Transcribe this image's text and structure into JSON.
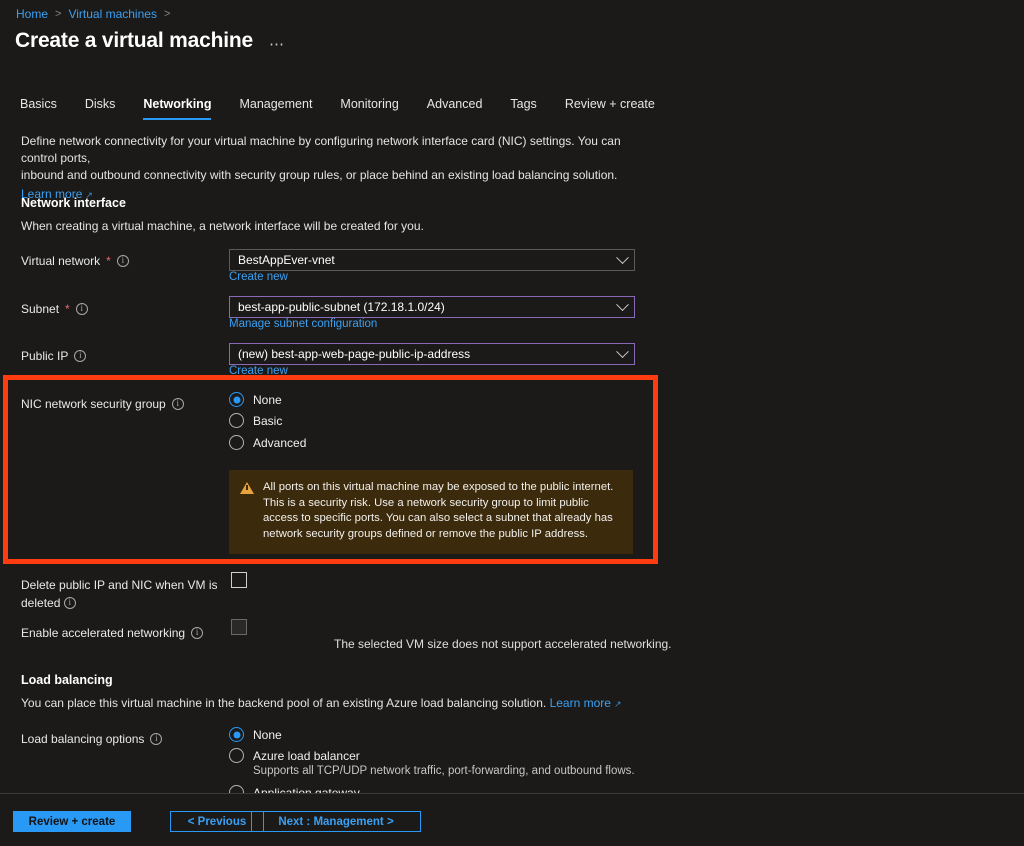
{
  "breadcrumb": {
    "home": "Home",
    "section": "Virtual machines"
  },
  "header": {
    "title": "Create a virtual machine",
    "more_label": "⋯"
  },
  "tabs": [
    {
      "label": "Basics",
      "active": false
    },
    {
      "label": "Disks",
      "active": false
    },
    {
      "label": "Networking",
      "active": true
    },
    {
      "label": "Management",
      "active": false
    },
    {
      "label": "Monitoring",
      "active": false
    },
    {
      "label": "Advanced",
      "active": false
    },
    {
      "label": "Tags",
      "active": false
    },
    {
      "label": "Review + create",
      "active": false
    }
  ],
  "intro": {
    "line1": "Define network connectivity for your virtual machine by configuring network interface card (NIC) settings. You can control ports,",
    "line2": "inbound and outbound connectivity with security group rules, or place behind an existing load balancing solution.",
    "learn_more": "Learn more"
  },
  "network_interface": {
    "heading": "Network interface",
    "subtext": "When creating a virtual machine, a network interface will be created for you.",
    "virtual_network": {
      "label": "Virtual network",
      "required": "*",
      "value": "BestAppEver-vnet",
      "sublink": "Create new"
    },
    "subnet": {
      "label": "Subnet",
      "required": "*",
      "value": "best-app-public-subnet (172.18.1.0/24)",
      "sublink": "Manage subnet configuration"
    },
    "public_ip": {
      "label": "Public IP",
      "value": "(new) best-app-web-page-public-ip-address",
      "sublink": "Create new"
    },
    "nic_nsg": {
      "label": "NIC network security group",
      "options": [
        {
          "label": "None",
          "selected": true
        },
        {
          "label": "Basic",
          "selected": false
        },
        {
          "label": "Advanced",
          "selected": false
        }
      ],
      "warning": "All ports on this virtual machine may be exposed to the public internet. This is a security risk. Use a network security group to limit public access to specific ports. You can also select a subnet that already has network security groups defined or remove the public IP address."
    },
    "delete_public_ip": {
      "label_line1": "Delete public IP and NIC when VM is",
      "label_line2": "deleted",
      "checked": false
    },
    "accelerated_networking": {
      "label": "Enable accelerated networking",
      "checked": false,
      "note": "The selected VM size does not support accelerated networking."
    }
  },
  "load_balancing": {
    "heading": "Load balancing",
    "subtext": "You can place this virtual machine in the backend pool of an existing Azure load balancing solution.",
    "learn_more": "Learn more",
    "options_label": "Load balancing options",
    "options": [
      {
        "label": "None",
        "selected": true,
        "desc": ""
      },
      {
        "label": "Azure load balancer",
        "selected": false,
        "desc": "Supports all TCP/UDP network traffic, port-forwarding, and outbound flows."
      },
      {
        "label": "Application gateway",
        "selected": false,
        "desc": ""
      }
    ]
  },
  "footer": {
    "review_create": "Review + create",
    "previous": "< Previous",
    "next": "Next : Management >"
  },
  "colors": {
    "background": "#1b1a19",
    "accent_blue": "#2899f5",
    "link_blue": "#3aa0f3",
    "annotation_red": "#ff3b10",
    "warning_bg": "#3b2a0b",
    "warning_icon": "#e8a33d",
    "violet_border": "#8a6ab8"
  }
}
